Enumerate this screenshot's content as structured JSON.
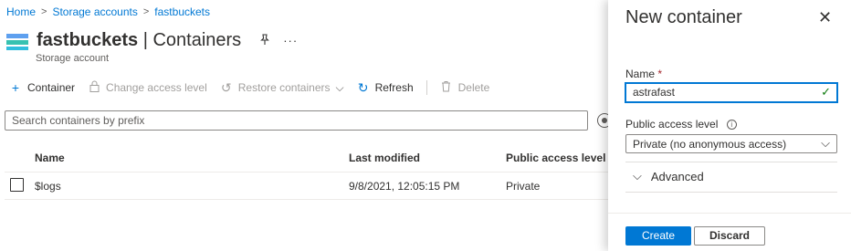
{
  "breadcrumb": {
    "items": [
      "Home",
      "Storage accounts",
      "fastbuckets"
    ],
    "separator": ">"
  },
  "header": {
    "title_bold": "fastbuckets",
    "title_rest": " | Containers",
    "subtitle": "Storage account",
    "pin_icon": "pin-icon",
    "more_icon": "···"
  },
  "toolbar": {
    "add_container": {
      "icon": "+",
      "label": "Container"
    },
    "change_access": {
      "icon": "🔒",
      "label": "Change access level"
    },
    "restore": {
      "icon": "↺",
      "label": "Restore containers",
      "chevron": "⌵"
    },
    "refresh": {
      "icon": "↻",
      "label": "Refresh"
    },
    "delete": {
      "icon": "🗑",
      "label": "Delete"
    }
  },
  "search": {
    "placeholder": "Search containers by prefix"
  },
  "table": {
    "columns": [
      "Name",
      "Last modified",
      "Public access level"
    ],
    "rows": [
      {
        "name": "$logs",
        "last_modified": "9/8/2021, 12:05:15 PM",
        "access": "Private"
      }
    ]
  },
  "panel": {
    "title": "New container",
    "close_icon": "✕",
    "name_label": "Name",
    "required_mark": "*",
    "name_value": "astrafast",
    "valid_icon": "✓",
    "access_label": "Public access level",
    "info_icon": "i",
    "access_value": "Private (no anonymous access)",
    "dropdown_chevron": "⌵",
    "advanced_chevron": "⌵",
    "advanced_label": "Advanced",
    "create_label": "Create",
    "discard_label": "Discard"
  },
  "colors": {
    "accent": "#0078d4",
    "success": "#107c10",
    "required": "#a4262c"
  }
}
